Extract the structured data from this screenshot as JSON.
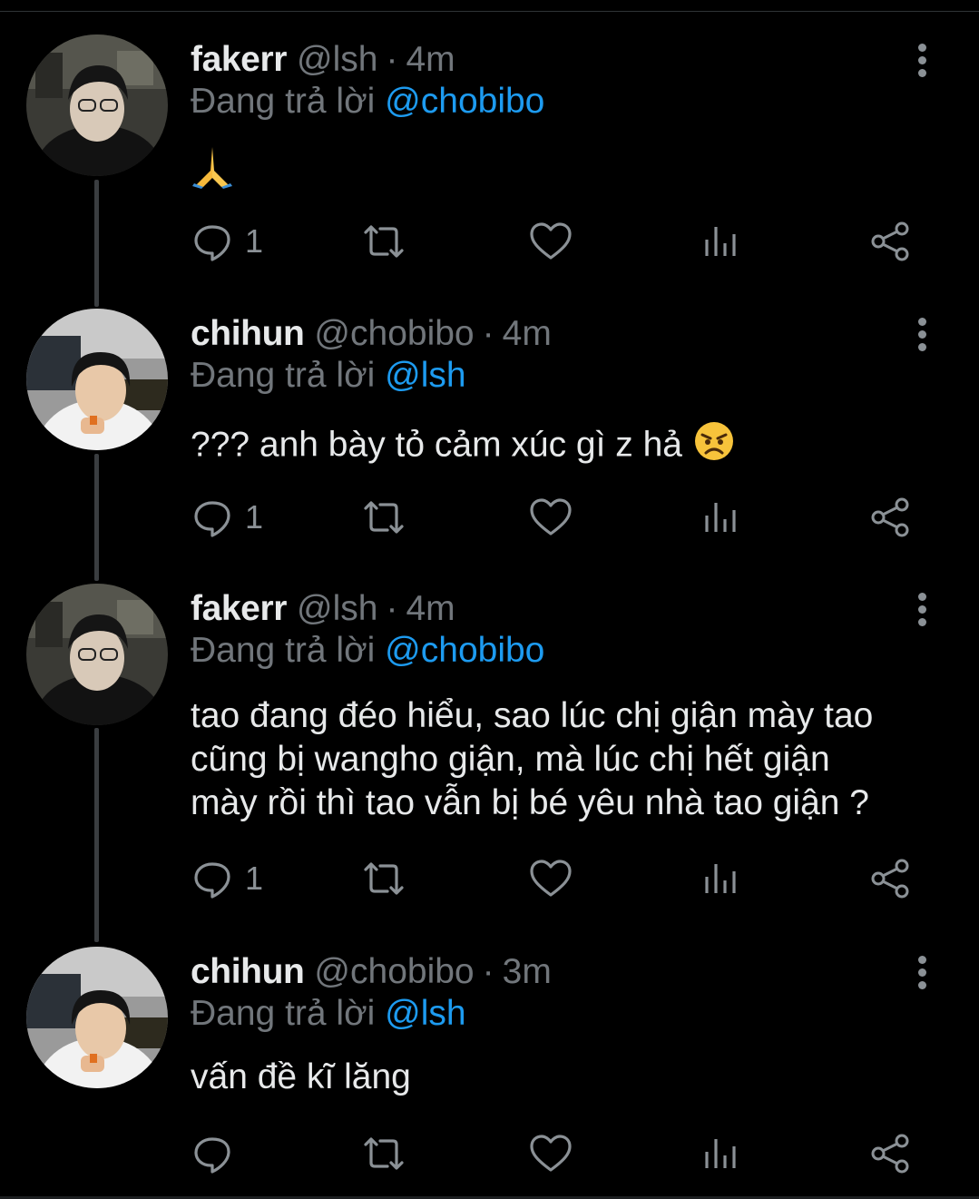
{
  "colors": {
    "background": "#000000",
    "name": "#e7e9ea",
    "muted": "#71767b",
    "link": "#1d9bf0",
    "icon": "#8b9196"
  },
  "tweets": [
    {
      "name": "fakerr",
      "handle": "@lsh",
      "dot": "·",
      "time": "4m",
      "reply_prefix": "Đang trả lời",
      "reply_to": "@chobibo",
      "text": "",
      "emoji": "folded-hands",
      "reply_count": "1"
    },
    {
      "name": "chihun",
      "handle": "@chobibo",
      "dot": "·",
      "time": "4m",
      "reply_prefix": "Đang trả lời",
      "reply_to": "@lsh",
      "text": "??? anh bày tỏ cảm xúc gì z hả",
      "emoji": "angry-face",
      "reply_count": "1"
    },
    {
      "name": "fakerr",
      "handle": "@lsh",
      "dot": "·",
      "time": "4m",
      "reply_prefix": "Đang trả lời",
      "reply_to": "@chobibo",
      "text_lines": [
        "tao đang đéo hiểu, sao lúc chị giận mày tao",
        "cũng bị wangho giận, mà lúc chị hết giận",
        "mày rồi thì tao vẫn bị bé yêu nhà tao giận ?"
      ],
      "reply_count": "1"
    },
    {
      "name": "chihun",
      "handle": "@chobibo",
      "dot": "·",
      "time": "3m",
      "reply_prefix": "Đang trả lời",
      "reply_to": "@lsh",
      "text": "vấn đề kĩ lăng",
      "reply_count": ""
    }
  ]
}
